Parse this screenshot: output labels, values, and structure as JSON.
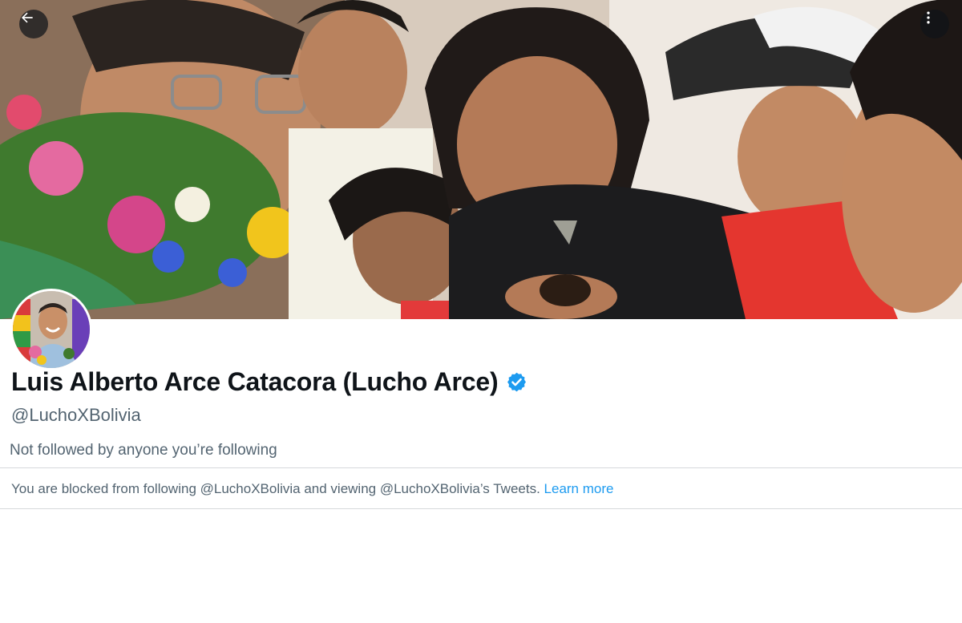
{
  "header": {
    "back_icon": "arrow-left-icon",
    "more_icon": "vertical-ellipsis-icon"
  },
  "profile": {
    "display_name": "Luis Alberto Arce Catacora (Lucho Arce)",
    "verified_icon": "verified-badge-icon",
    "handle": "@LuchoXBolivia",
    "followed_by": "Not followed by anyone you’re following"
  },
  "blocked": {
    "message": "You are blocked from following @LuchoXBolivia and viewing @LuchoXBolivia’s Tweets.",
    "link_label": "Learn more"
  },
  "colors": {
    "text_primary": "#0f1419",
    "text_secondary": "#536471",
    "link": "#1d9bf0",
    "verified": "#1d9bf0",
    "divider": "#d6d9db"
  }
}
